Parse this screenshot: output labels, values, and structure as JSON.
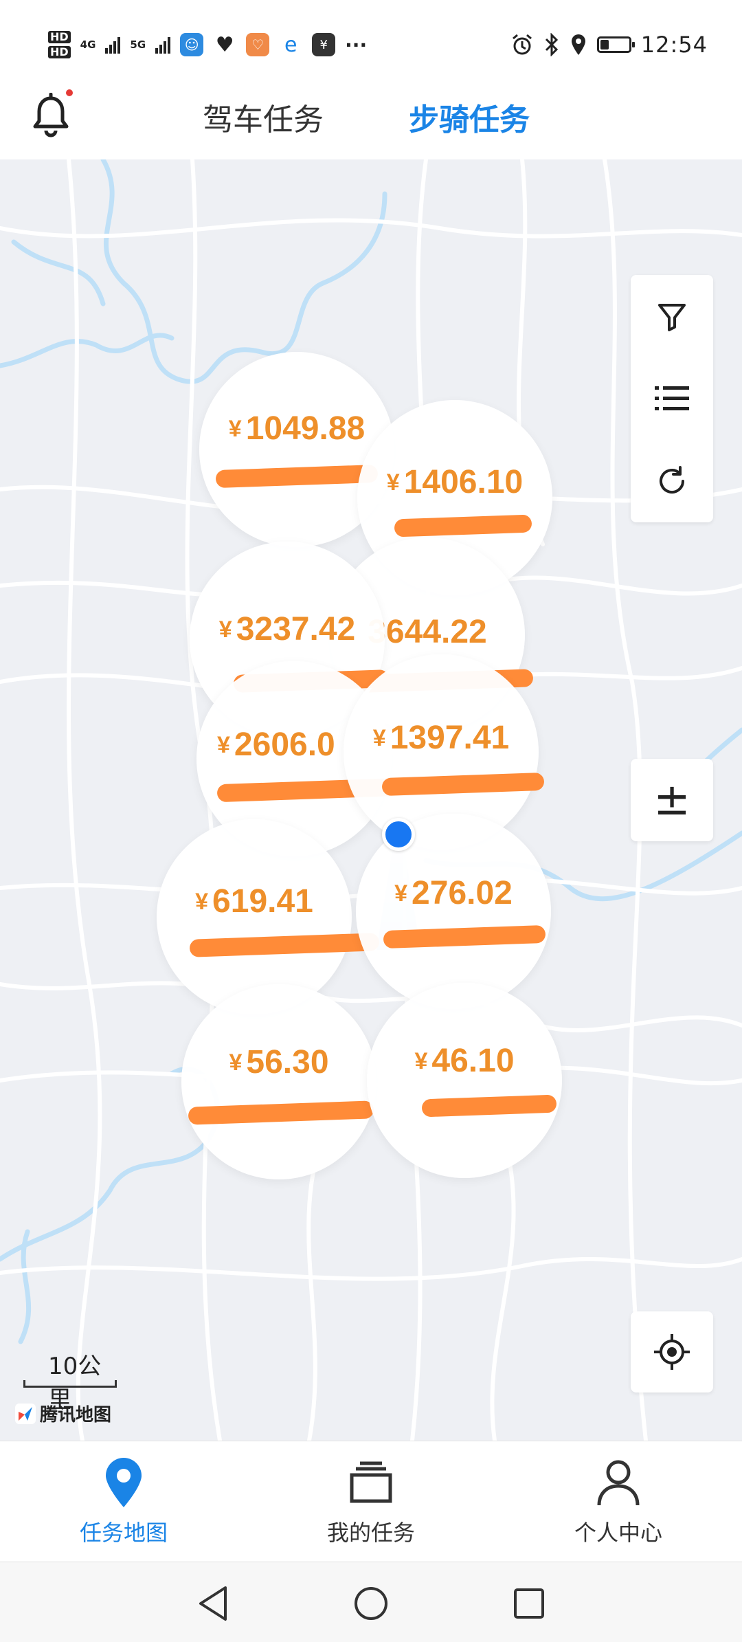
{
  "status_bar": {
    "time": "12:54",
    "hd1": "HD",
    "hd2": "HD",
    "net1": "4G",
    "net2": "5G",
    "more": "···",
    "battery_fraction": 0.3
  },
  "header": {
    "tabs": [
      {
        "label": "驾车任务",
        "active": false
      },
      {
        "label": "步骑任务",
        "active": true
      }
    ]
  },
  "map": {
    "tools": [
      "filter-icon",
      "list-icon",
      "refresh-icon"
    ],
    "zoom_symbol": "±",
    "currency": "¥",
    "clusters": [
      {
        "amount": "1049.88"
      },
      {
        "amount": "1406.10"
      },
      {
        "amount": "3237.42"
      },
      {
        "amount": "3644.22"
      },
      {
        "amount": "2606.0"
      },
      {
        "amount": "1397.41"
      },
      {
        "amount": "619.41"
      },
      {
        "amount": "276.02"
      },
      {
        "amount": "56.30"
      },
      {
        "amount": "46.10"
      }
    ],
    "scale_label": "10公里",
    "provider": "腾讯地图"
  },
  "bottom_nav": [
    {
      "label": "任务地图",
      "icon": "map-pin-icon",
      "active": true
    },
    {
      "label": "我的任务",
      "icon": "stack-icon",
      "active": false
    },
    {
      "label": "个人中心",
      "icon": "person-icon",
      "active": false
    }
  ],
  "colors": {
    "accent": "#1a84e6",
    "price": "#ee8f2a",
    "scribble": "#ff8b38",
    "map_bg": "#eef0f4",
    "water": "#bfe0f7"
  }
}
